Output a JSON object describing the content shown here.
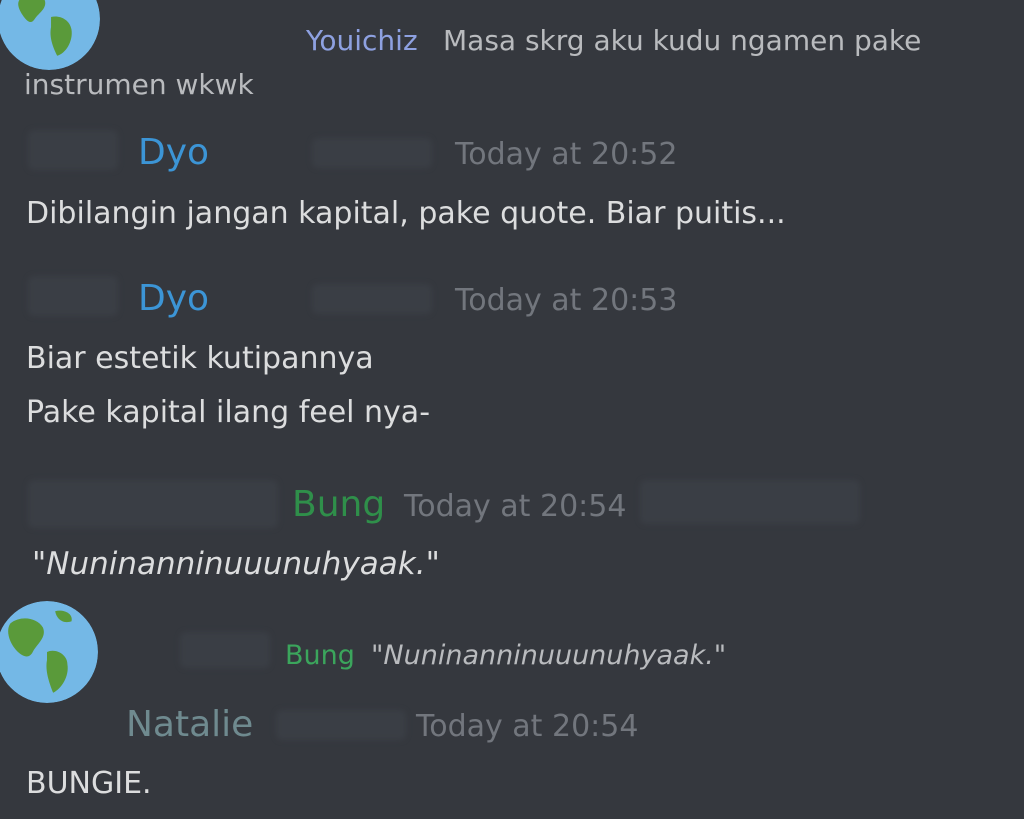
{
  "messages": [
    {
      "reply_preview": {
        "username": "Youichiz",
        "text": "Masa skrg aku kudu ngamen pake",
        "continuation": "instrumen wkwk"
      }
    },
    {
      "username": "Dyo",
      "username_color": "#3c95d6",
      "timestamp": "Today at 20:52",
      "lines": [
        "Dibilangin jangan kapital, pake quote. Biar puitis..."
      ]
    },
    {
      "username": "Dyo",
      "username_color": "#3c95d6",
      "timestamp": "Today at 20:53",
      "lines": [
        "Biar estetik kutipannya",
        "Pake kapital ilang feel nya-"
      ]
    },
    {
      "username": "Bung",
      "username_color": "#2f8f4a",
      "timestamp": "Today at 20:54",
      "lines": [
        "\"Nuninanninuuunuhyaak.\""
      ]
    },
    {
      "reply_preview": {
        "username": "Bung",
        "text": "\"Nuninanninuuunuhyaak.\""
      },
      "username": "Natalie",
      "username_color": "#6f8a8f",
      "timestamp": "Today at 20:54",
      "lines": [
        "BUNGIE."
      ]
    }
  ],
  "icons": {
    "avatar": "earth-globe-icon"
  },
  "colors": {
    "background": "#35383e",
    "text": "#dcddde",
    "muted": "#72767d",
    "reply_user": "#8ea1e1"
  }
}
